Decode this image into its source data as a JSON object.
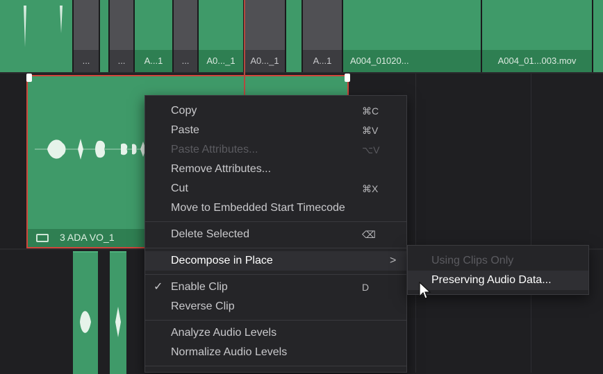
{
  "timeline": {
    "top_track_clips": [
      {
        "label": "",
        "style": "green"
      },
      {
        "label": "...",
        "style": "gray"
      },
      {
        "label": "",
        "style": "green"
      },
      {
        "label": "...",
        "style": "gray"
      },
      {
        "label": "A...1",
        "style": "green"
      },
      {
        "label": "...",
        "style": "gray"
      },
      {
        "label": "A0..._1",
        "style": "green"
      },
      {
        "label": "A0..._1",
        "style": "gray"
      },
      {
        "label": "",
        "style": "green"
      },
      {
        "label": "A...1",
        "style": "gray"
      },
      {
        "label": "A004_01020...",
        "style": "green"
      },
      {
        "label": "A004_01...003.mov",
        "style": "green"
      },
      {
        "label": "",
        "style": "green"
      }
    ],
    "selected_clip": {
      "label": "3 ADA VO_1"
    },
    "colors": {
      "clip_green": "#3f9a69",
      "clip_label_bg": "#2e7f52",
      "selection_border": "#d0453b",
      "playhead": "#b44a40",
      "menu_bg": "#252528"
    }
  },
  "context_menu": {
    "items": [
      {
        "label": "Copy",
        "shortcut": "⌘C",
        "enabled": true
      },
      {
        "label": "Paste",
        "shortcut": "⌘V",
        "enabled": true
      },
      {
        "label": "Paste Attributes...",
        "shortcut": "⌥V",
        "enabled": false
      },
      {
        "label": "Remove Attributes...",
        "shortcut": "",
        "enabled": true
      },
      {
        "label": "Cut",
        "shortcut": "⌘X",
        "enabled": true
      },
      {
        "label": "Move to Embedded Start Timecode",
        "shortcut": "",
        "enabled": true
      },
      {
        "label": "Delete Selected",
        "shortcut": "⌫",
        "enabled": true
      },
      {
        "label": "Decompose in Place",
        "shortcut": "",
        "enabled": true,
        "submenu": true,
        "highlighted": true
      },
      {
        "label": "Enable Clip",
        "shortcut": "D",
        "enabled": true,
        "checked": true
      },
      {
        "label": "Reverse Clip",
        "shortcut": "",
        "enabled": true
      },
      {
        "label": "Analyze Audio Levels",
        "shortcut": "",
        "enabled": true
      },
      {
        "label": "Normalize Audio Levels",
        "shortcut": "",
        "enabled": true
      }
    ],
    "submenu_arrow": ">",
    "check_mark": "✓"
  },
  "submenu": {
    "items": [
      {
        "label": "Using Clips Only",
        "enabled": false
      },
      {
        "label": "Preserving Audio Data...",
        "enabled": true,
        "highlighted": true
      }
    ]
  },
  "icons": {
    "clip_type": "clip-layers-icon",
    "cursor": "mouse-pointer-icon",
    "delete_key": "delete-key-icon"
  }
}
